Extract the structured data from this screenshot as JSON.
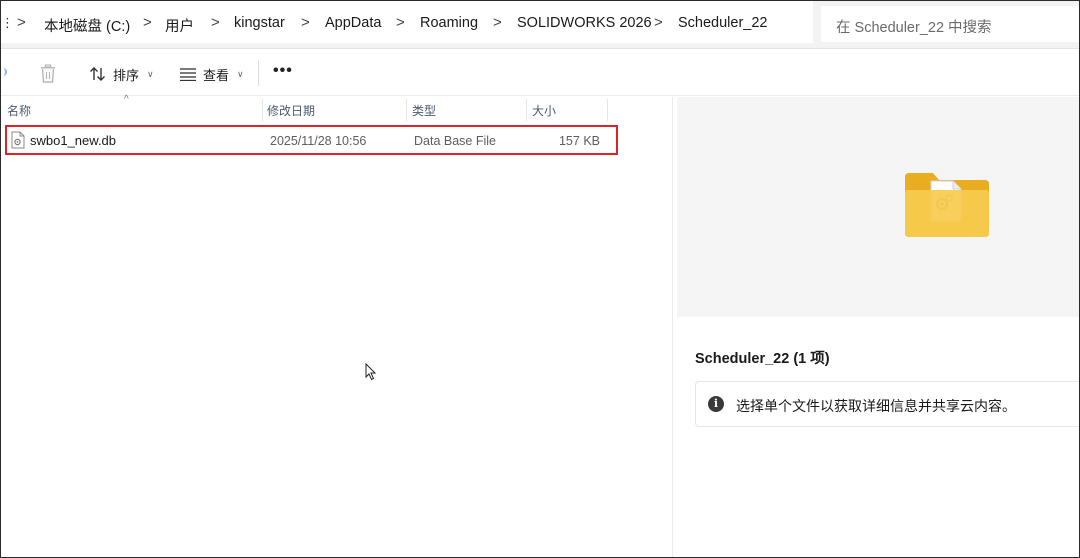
{
  "breadcrumb": {
    "items": [
      "本地磁盘 (C:)",
      "用户",
      "kingstar",
      "AppData",
      "Roaming",
      "SOLIDWORKS 2026",
      "Scheduler_22"
    ],
    "separator": ">"
  },
  "search": {
    "placeholder": "在 Scheduler_22 中搜索"
  },
  "toolbar": {
    "sort_label": "排序",
    "view_label": "查看",
    "more_label": "•••"
  },
  "columns": {
    "name": "名称",
    "date": "修改日期",
    "type": "类型",
    "size": "大小"
  },
  "files": [
    {
      "name": "swbo1_new.db",
      "date": "2025/11/28 10:56",
      "type": "Data Base File",
      "size": "157 KB",
      "highlighted": true
    }
  ],
  "details": {
    "title": "Scheduler_22 (1 项)",
    "info": "选择单个文件以获取详细信息并共享云内容。"
  },
  "colors": {
    "highlight": "#e0222b",
    "folder": "#f5c33b",
    "header_text": "#4c5a6e"
  }
}
